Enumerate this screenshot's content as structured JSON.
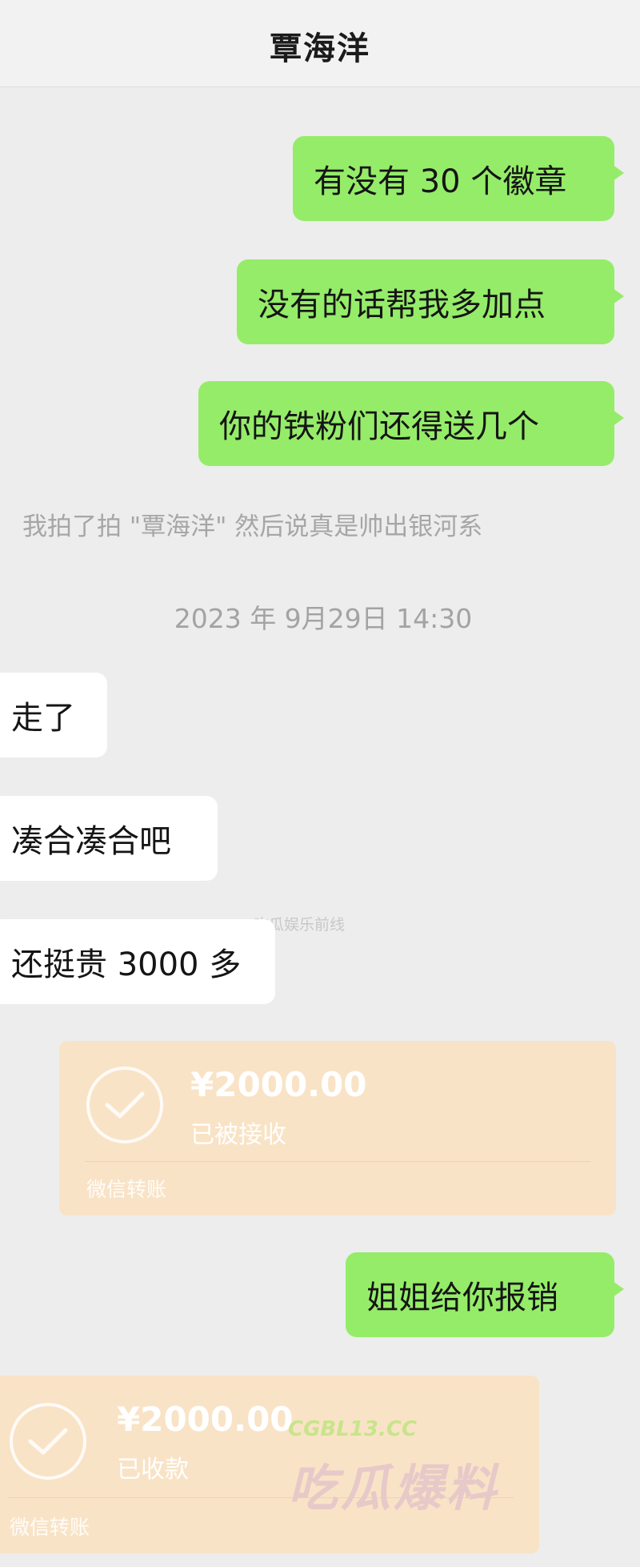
{
  "header": {
    "title": "覃海洋"
  },
  "messages": {
    "out1": "有没有 30 个徽章",
    "out2": "没有的话帮我多加点",
    "out3": "你的铁粉们还得送几个"
  },
  "system_note": "我拍了拍 \"覃海洋\" 然后说真是帅出银河系",
  "timestamp": "2023 年 9月29日 14:30",
  "incoming": {
    "in1": "走了",
    "in2": "凑合凑合吧",
    "in3": "还挺贵 3000 多"
  },
  "transfer1": {
    "amount": "¥2000.00",
    "status": "已被接收",
    "label": "微信转账"
  },
  "reimburse": "姐姐给你报销",
  "transfer2": {
    "amount": "¥2000.00",
    "status": "已收款",
    "label": "微信转账"
  },
  "watermark": {
    "small": "@吃瓜娱乐前线",
    "site": "CGBL13.CC",
    "brand": "吃瓜爆料"
  }
}
